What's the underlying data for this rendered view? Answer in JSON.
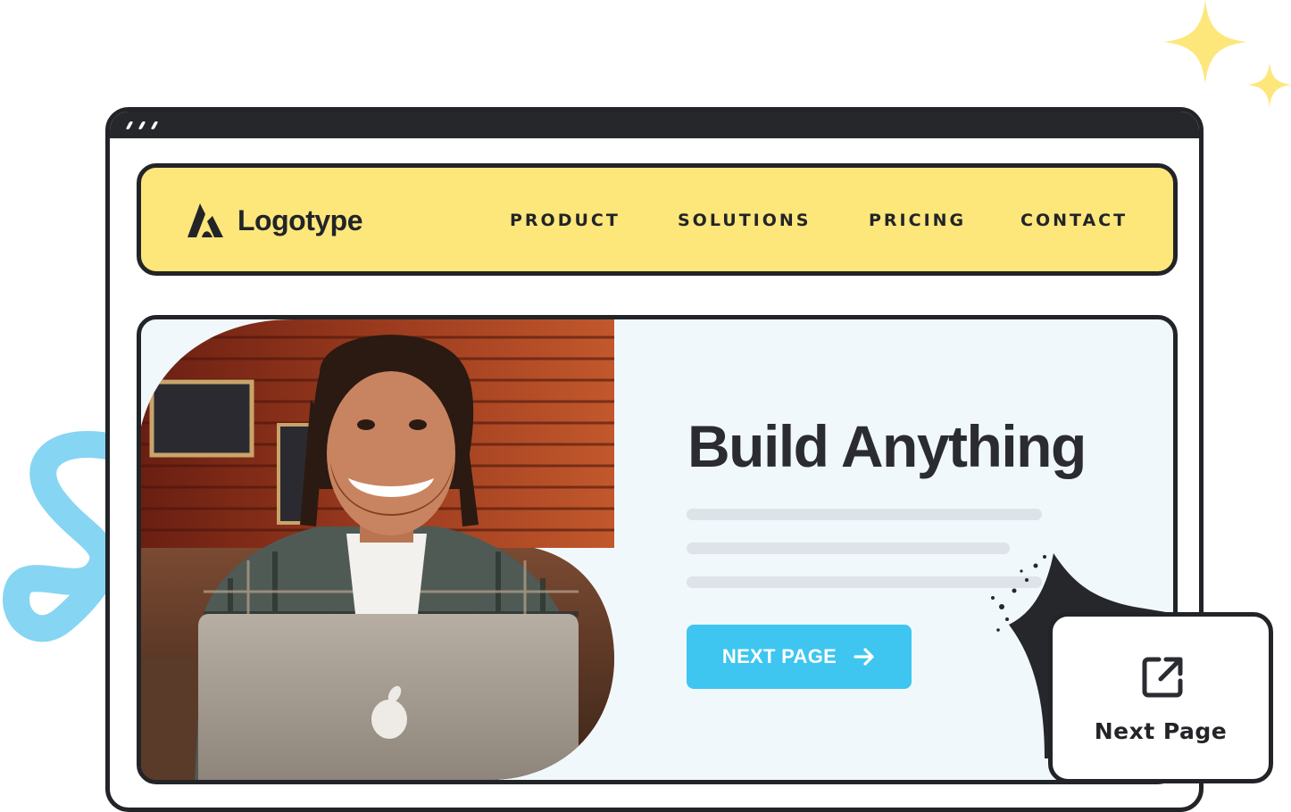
{
  "brand": {
    "logo_text": "Logotype",
    "logo_icon": "logotype-mark-icon"
  },
  "nav": {
    "items": [
      {
        "label": "PRODUCT"
      },
      {
        "label": "SOLUTIONS"
      },
      {
        "label": "PRICING"
      },
      {
        "label": "CONTACT"
      }
    ]
  },
  "hero": {
    "title": "Build Anything",
    "cta_label": "NEXT PAGE",
    "cta_icon": "arrow-right-icon",
    "image": "smiling-man-with-laptop-photo"
  },
  "floating_card": {
    "label": "Next Page",
    "icon": "external-link-icon"
  },
  "colors": {
    "navbar_bg": "#fde77b",
    "hero_bg": "#f1f8fc",
    "accent_blue": "#3ec6f0",
    "outline": "#222428",
    "sparkle": "#fde77b"
  }
}
